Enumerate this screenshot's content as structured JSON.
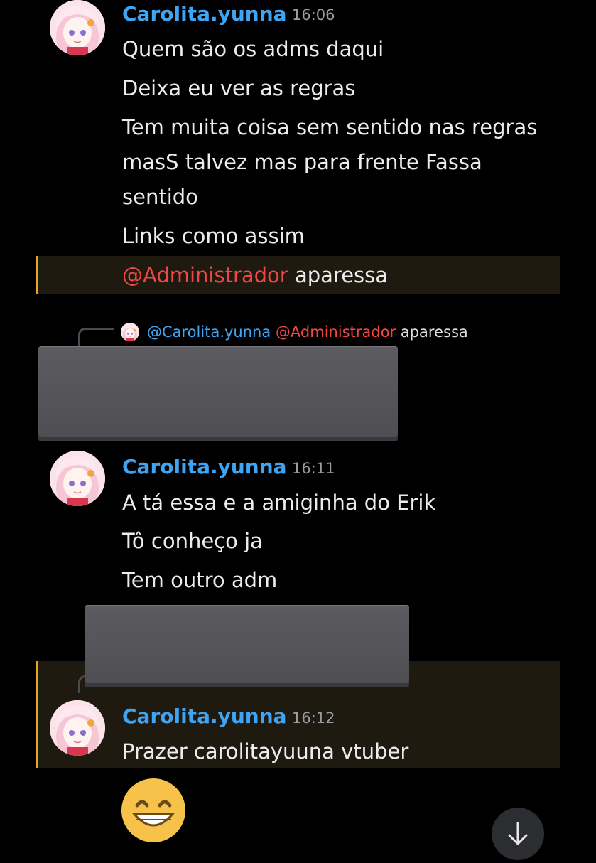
{
  "messages": [
    {
      "username": "Carolita.yunna",
      "time": "16:06",
      "lines": [
        "Quem são os adms daqui",
        "Deixa eu ver as regras",
        "Tem muita coisa sem sentido nas regras",
        "masS talvez mas para frente Fassa",
        "sentido",
        "Links como assim"
      ],
      "mention_line": {
        "mention": "@Administrador",
        "text": " aparessa"
      }
    },
    {
      "reply": {
        "user": "@Carolita.yunna",
        "mention": "@Administrador",
        "text": " aparessa"
      }
    },
    {
      "username": "Carolita.yunna",
      "time": "16:11",
      "lines": [
        "A tá essa e a amiginha do Erik",
        "Tô conheço ja",
        "Tem outro adm"
      ]
    },
    {
      "username": "Carolita.yunna",
      "time": "16:12",
      "lines": [
        "Prazer carolitayuuna vtuber"
      ],
      "emoji": "😁"
    }
  ],
  "icons": {
    "scroll_down": "arrow-down-icon",
    "reply": "reply-connector-icon"
  },
  "colors": {
    "username": "#3fa5f3",
    "mention": "#f04646",
    "mention_highlight_bar": "#e6a720",
    "background": "#000000"
  }
}
